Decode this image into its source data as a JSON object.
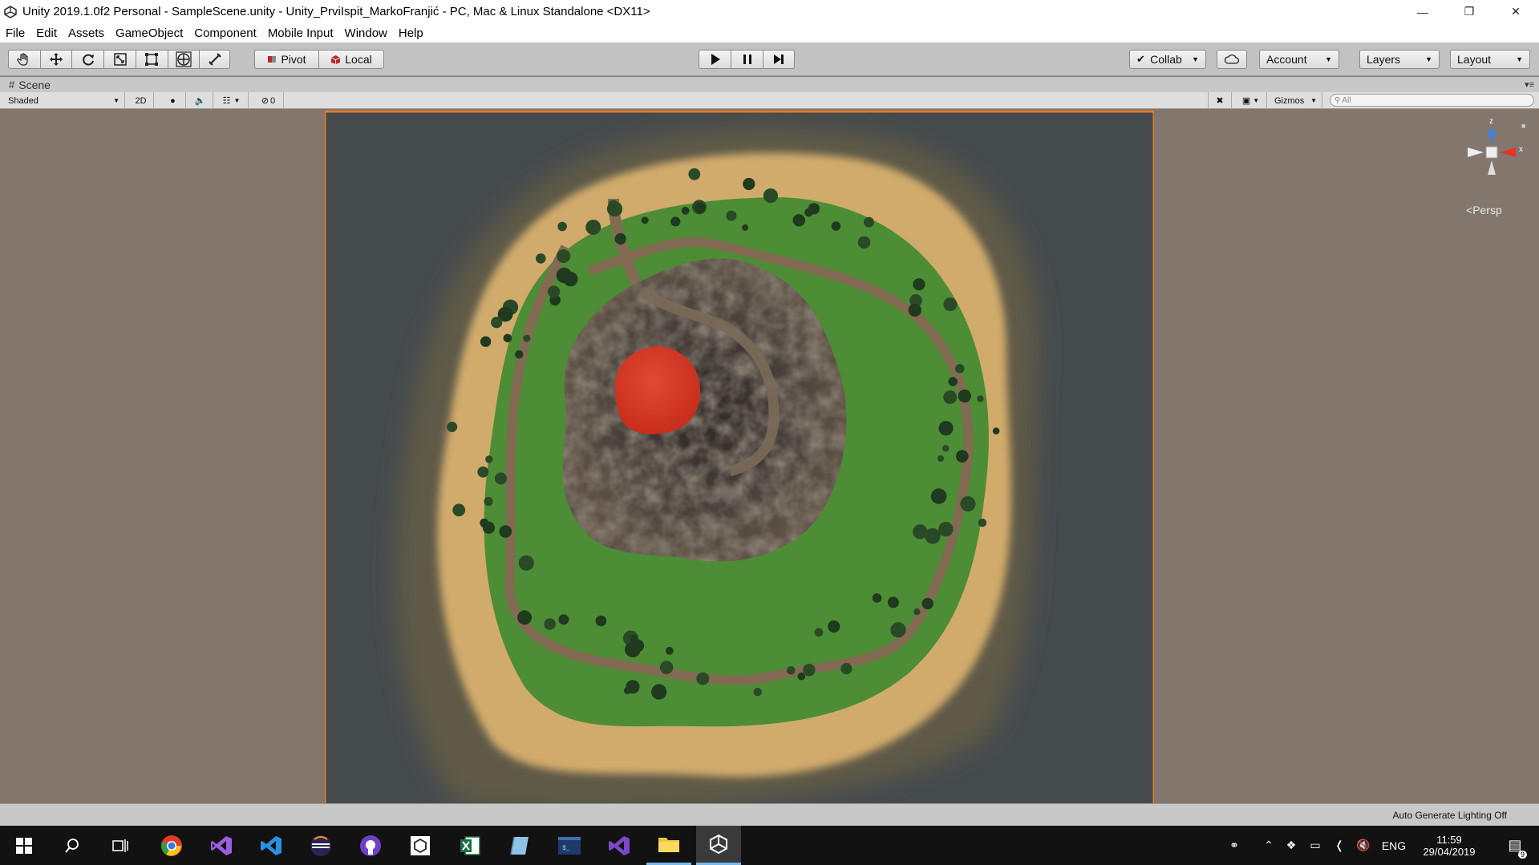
{
  "window": {
    "title": "Unity 2019.1.0f2 Personal - SampleScene.unity - Unity_PrviIspit_MarkoFranjić - PC, Mac & Linux Standalone <DX11>"
  },
  "menu": [
    "File",
    "Edit",
    "Assets",
    "GameObject",
    "Component",
    "Mobile Input",
    "Window",
    "Help"
  ],
  "toolbar": {
    "tools": [
      "hand-tool",
      "move-tool",
      "rotate-tool",
      "scale-tool",
      "rect-tool",
      "transform-tool",
      "custom-tool"
    ],
    "pivot_label": "Pivot",
    "local_label": "Local",
    "collab_label": "Collab",
    "account_label": "Account",
    "layers_label": "Layers",
    "layout_label": "Layout"
  },
  "scene": {
    "tab_label": "Scene",
    "shading_mode": "Shaded",
    "mode_2d_label": "2D",
    "hidden_count": "0",
    "gizmos_label": "Gizmos",
    "search_placeholder": "All",
    "projection_label": "Persp",
    "axis_x": "x",
    "axis_z": "z"
  },
  "status": {
    "lighting": "Auto Generate Lighting Off"
  },
  "taskbar": {
    "apps": [
      "windows-start",
      "search",
      "task-view",
      "chrome",
      "visual-studio",
      "vscode",
      "eclipse",
      "github-desktop",
      "unity-hub",
      "excel",
      "notes",
      "terminal",
      "visual-studio-alt",
      "file-explorer",
      "unity"
    ],
    "language": "ENG",
    "time": "11:59",
    "date": "29/04/2019",
    "notification_count": "9"
  },
  "colors": {
    "selection_outline": "#f07a1c",
    "lava": "#d83a26",
    "grass": "#4c8a36",
    "sand": "#d4ad6a",
    "water": "#464b4e"
  }
}
